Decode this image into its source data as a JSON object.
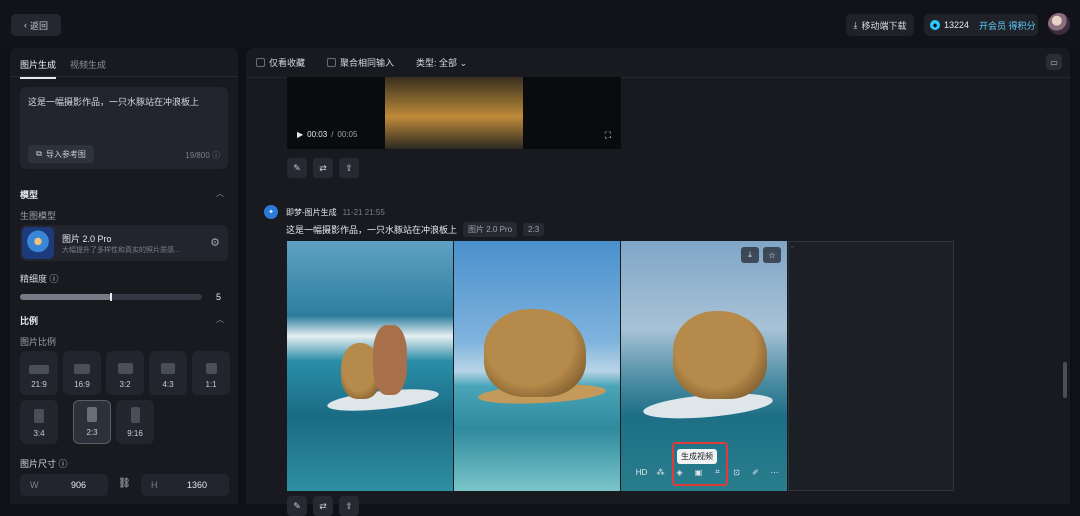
{
  "topbar": {
    "back_label": "返回",
    "download_label": "移动端下载",
    "points": "13224",
    "vip_label": "开会员 得积分"
  },
  "left": {
    "tabs": [
      "图片生成",
      "视频生成"
    ],
    "prompt": {
      "text": "这是一幅摄影作品，一只水豚站在冲浪板上",
      "import_label": "导入参考图",
      "count": "19/800"
    },
    "model_section": "模型",
    "model_sub": "生图模型",
    "model": {
      "name": "图片 2.0 Pro",
      "desc": "大幅提升了多样性和真实的照片质感..."
    },
    "precision": {
      "label": "精细度",
      "value": "5",
      "level": 0.5
    },
    "ratio_section": "比例",
    "ratio_sub": "图片比例",
    "ratios": [
      "21:9",
      "16:9",
      "3:2",
      "4:3",
      "1:1",
      "3:4",
      "2:3",
      "9:16"
    ],
    "selected_ratio": "2:3",
    "size": {
      "label": "图片尺寸",
      "w_label": "W",
      "w": "906",
      "h_label": "H",
      "h": "1360"
    }
  },
  "main": {
    "filters": {
      "fav": "仅看收藏",
      "merge": "聚合相同输入",
      "type": "类型: 全部"
    },
    "video": {
      "time": "00:03",
      "total": "00:05"
    },
    "gen": {
      "title": "即梦-图片生成",
      "time": "11-21 21:55",
      "prompt": "这是一幅摄影作品，一只水豚站在冲浪板上",
      "model_chip": "图片 2.0 Pro",
      "ratio_chip": "2:3"
    },
    "tooltip": "生成视频",
    "hd_label": "HD"
  },
  "colors": {
    "accent": "#2bc9ff",
    "highlight": "#e03a3a"
  }
}
